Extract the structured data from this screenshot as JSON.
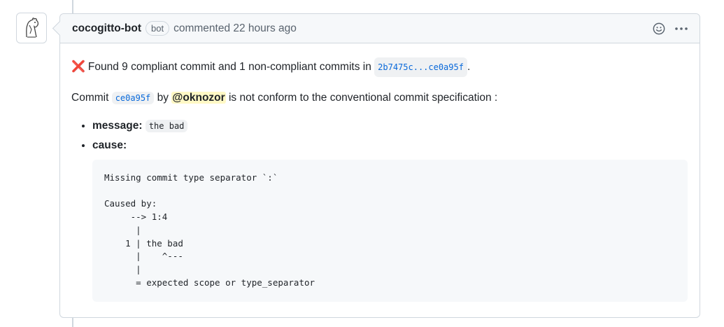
{
  "comment": {
    "author": "cocogitto-bot",
    "badge": "bot",
    "meta": "commented 22 hours ago",
    "icons": {
      "emoji": "smiley-icon",
      "menu": "kebab-horizontal-icon",
      "avatar": "bot-avatar-icon"
    }
  },
  "body": {
    "summary_prefix": "Found 9 compliant commit and 1 non-compliant commits in",
    "summary_range": "2b7475c...ce0a95f",
    "summary_suffix": ".",
    "commit_word": "Commit",
    "commit_sha": "ce0a95f",
    "by_word": "by",
    "mention": "@oknozor",
    "conform_text": "is not conform to the conventional commit specification :",
    "message_label": "message:",
    "message_value": "the bad",
    "cause_label": "cause:",
    "cause_block": "Missing commit type separator `:`\n\nCaused by:\n     --> 1:4\n      |\n    1 | the bad\n      |    ^---\n      |\n      = expected scope or type_separator"
  },
  "colors": {
    "error": "#e0302a",
    "link": "#0969da",
    "mention_bg": "#fff8c5"
  }
}
